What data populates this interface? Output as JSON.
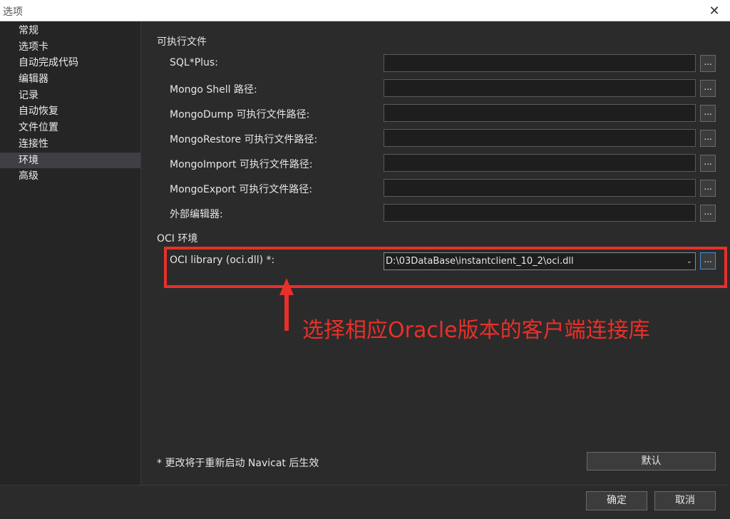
{
  "window": {
    "title": "选项"
  },
  "sidebar": {
    "items": [
      {
        "label": "常规"
      },
      {
        "label": "选项卡"
      },
      {
        "label": "自动完成代码"
      },
      {
        "label": "编辑器"
      },
      {
        "label": "记录"
      },
      {
        "label": "自动恢复"
      },
      {
        "label": "文件位置"
      },
      {
        "label": "连接性"
      },
      {
        "label": "环境",
        "active": true
      },
      {
        "label": "高级"
      }
    ]
  },
  "main": {
    "executables_section": "可执行文件",
    "fields": [
      {
        "label": "SQL*Plus:",
        "value": ""
      },
      {
        "label": "Mongo Shell 路径:",
        "value": ""
      },
      {
        "label": "MongoDump 可执行文件路径:",
        "value": ""
      },
      {
        "label": "MongoRestore 可执行文件路径:",
        "value": ""
      },
      {
        "label": "MongoImport 可执行文件路径:",
        "value": ""
      },
      {
        "label": "MongoExport 可执行文件路径:",
        "value": ""
      },
      {
        "label": "外部编辑器:",
        "value": ""
      }
    ],
    "browse_label": "...",
    "oci_section": "OCI 环境",
    "oci": {
      "label": "OCI library (oci.dll) *:",
      "value": "D:\\03DataBase\\instantclient_10_2\\oci.dll",
      "arrow": "⌄"
    },
    "annotation": {
      "text": "选择相应Oracle版本的客户端连接库",
      "color": "#e8302a"
    },
    "footnote": "* 更改将于重新启动 Navicat 后生效",
    "default_button": "默认"
  },
  "footer": {
    "ok_label": "确定",
    "cancel_label": "取消"
  },
  "icons": {
    "close": "✕"
  }
}
